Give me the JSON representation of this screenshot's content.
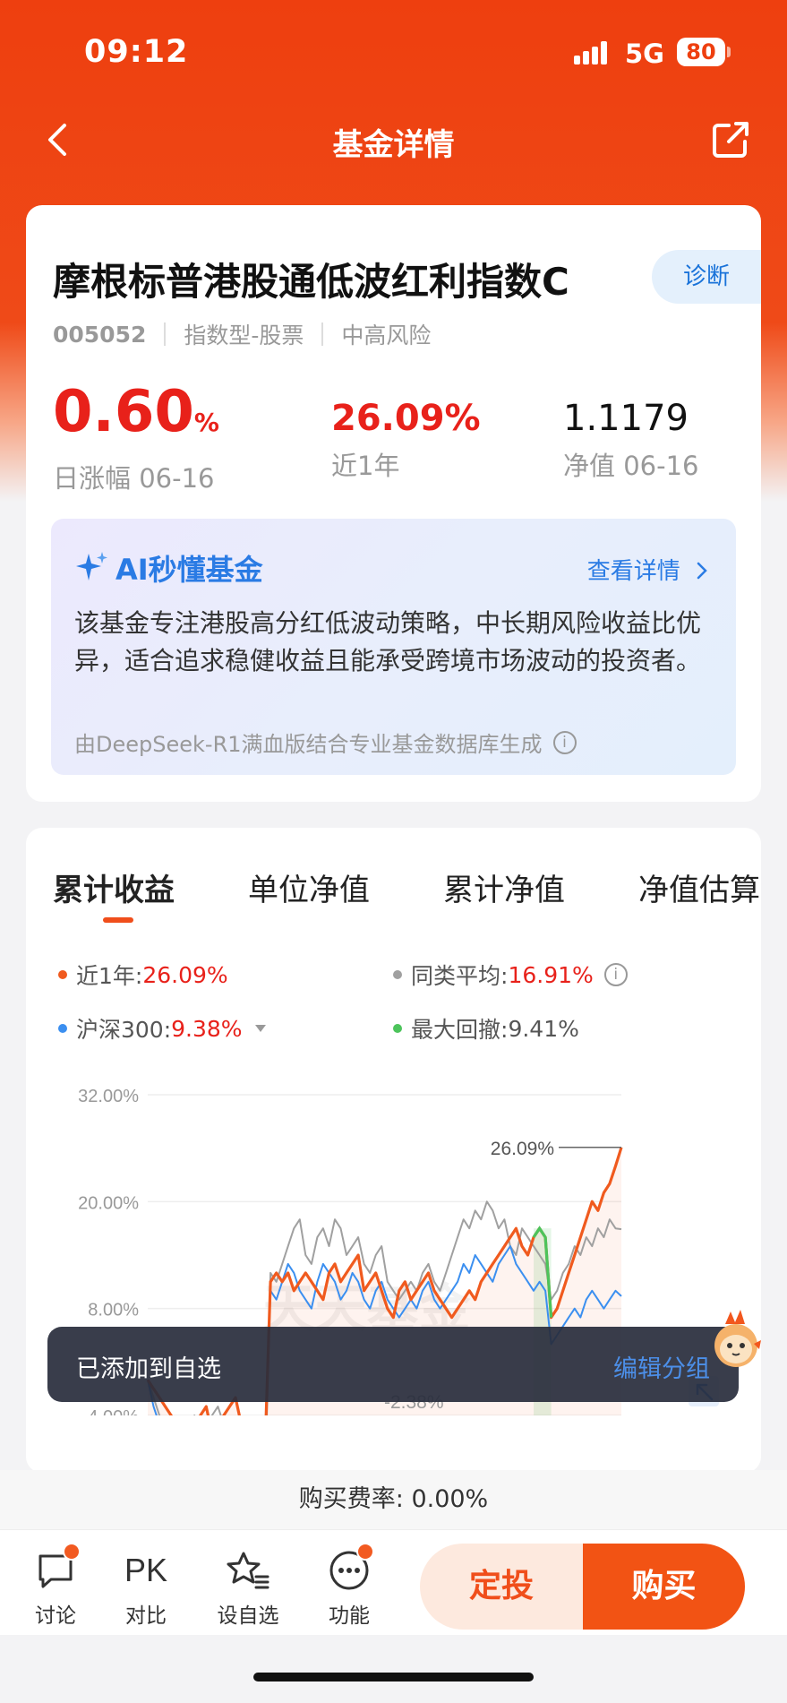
{
  "status_bar": {
    "time": "09:12",
    "network": "5G",
    "battery": "80"
  },
  "nav": {
    "title": "基金详情",
    "back_icon": "chevron-left-icon",
    "share_icon": "share-icon"
  },
  "fund": {
    "name": "摩根标普港股通低波红利指数C",
    "diagnose": "诊断",
    "code": "005052",
    "type": "指数型-股票",
    "risk": "中高风险",
    "daily_change_value": "0.60",
    "daily_change_unit": "%",
    "daily_change_label": "日涨幅 06-16",
    "year_return_value": "26.09%",
    "year_return_label": "近1年",
    "nav_value": "1.1179",
    "nav_label": "净值 06-16"
  },
  "ai": {
    "title": "AI秒懂基金",
    "more": "查看详情",
    "text": "该基金专注港股高分红低波动策略，中长期风险收益比优异，适合追求稳健收益且能承受跨境市场波动的投资者。",
    "source": "由DeepSeek-R1满血版结合专业基金数据库生成"
  },
  "chart_tabs": [
    "累计收益",
    "单位净值",
    "累计净值",
    "净值估算"
  ],
  "legend": {
    "fund_label": "近1年:",
    "fund_value": "26.09%",
    "peer_label": "同类平均:",
    "peer_value": "16.91%",
    "index_label": "沪深300:",
    "index_value": "9.38%",
    "drawdown_label": "最大回撤:",
    "drawdown_value": "9.41%"
  },
  "chart_data": {
    "type": "line",
    "ylim": [
      -4,
      32
    ],
    "y_ticks": [
      "32.00%",
      "20.00%",
      "8.00%",
      "-4.00%"
    ],
    "end_label": "26.09%",
    "min_label": "-2.38%",
    "watermark": "天天基金",
    "series": [
      {
        "name": "近1年",
        "color": "#f05a1e",
        "values": [
          0,
          -1,
          -2,
          -3,
          -4,
          -5,
          -6,
          -6,
          -5,
          -4,
          -3,
          -6,
          -5,
          -4,
          -3,
          -2,
          -5,
          -6,
          -7,
          -8,
          -9,
          11,
          12,
          11,
          12,
          10,
          11,
          12,
          11,
          10,
          9,
          12,
          13,
          11,
          12,
          13,
          14,
          10,
          11,
          12,
          10,
          8,
          7,
          10,
          11,
          9,
          10,
          11,
          12,
          10,
          9,
          8,
          7,
          8,
          9,
          10,
          9,
          11,
          12,
          13,
          14,
          15,
          16,
          17,
          15,
          14,
          16,
          17,
          16,
          7,
          8,
          10,
          12,
          14,
          16,
          18,
          20,
          19,
          21,
          22,
          24,
          26.09
        ]
      },
      {
        "name": "同类平均",
        "color": "#a0a0a0",
        "values": [
          0,
          -2,
          -4,
          -6,
          -8,
          -7,
          -6,
          -5,
          -4,
          -6,
          -5,
          -4,
          -3,
          -5,
          -6,
          -8,
          -9,
          -11,
          -12,
          -13,
          -14,
          12,
          11,
          13,
          15,
          17,
          18,
          14,
          13,
          16,
          17,
          15,
          18,
          17,
          14,
          15,
          16,
          13,
          12,
          14,
          15,
          11,
          10,
          9,
          10,
          11,
          10,
          12,
          13,
          11,
          10,
          12,
          14,
          16,
          18,
          17,
          19,
          18,
          20,
          19,
          17,
          18,
          15,
          14,
          17,
          16,
          15,
          14,
          13,
          9,
          10,
          12,
          13,
          15,
          14,
          16,
          15,
          17,
          16,
          18,
          17,
          16.91
        ]
      },
      {
        "name": "沪深300",
        "color": "#3b8ff0",
        "values": [
          0,
          -3,
          -5,
          -7,
          -9,
          -8,
          -7,
          -9,
          -10,
          -11,
          -12,
          -10,
          -9,
          -11,
          -12,
          -13,
          -14,
          -13,
          -12,
          -11,
          -10,
          10,
          9,
          11,
          13,
          12,
          10,
          9,
          8,
          11,
          13,
          12,
          11,
          9,
          10,
          12,
          11,
          9,
          8,
          10,
          11,
          9,
          8,
          7,
          8,
          9,
          8,
          10,
          11,
          9,
          8,
          9,
          10,
          11,
          13,
          12,
          14,
          13,
          12,
          11,
          13,
          14,
          15,
          13,
          12,
          11,
          10,
          11,
          10,
          4,
          5,
          6,
          7,
          8,
          7,
          9,
          10,
          9,
          8,
          9,
          10,
          9.38
        ]
      }
    ]
  },
  "toast": {
    "text": "已添加到自选",
    "action": "编辑分组"
  },
  "fee": "购买费率: 0.00%",
  "bottom": {
    "items": [
      "讨论",
      "对比",
      "设自选",
      "功能"
    ],
    "pk_text": "PK",
    "btn_sip": "定投",
    "btn_buy": "购买"
  }
}
